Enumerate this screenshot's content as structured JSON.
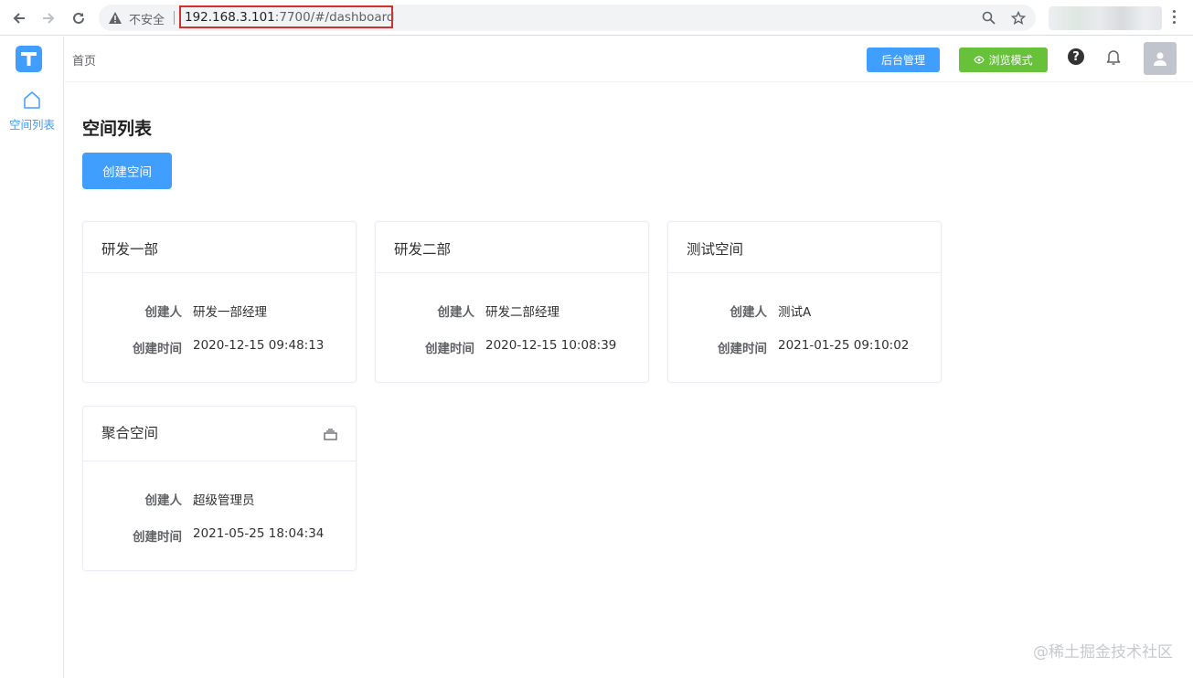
{
  "browser": {
    "insecure_label": "不安全",
    "url_host": "192.168.3.101",
    "url_rest": ":7700/#/dashboard"
  },
  "sidebar": {
    "logo_letter": "T",
    "items": [
      {
        "label": "空间列表",
        "icon": "home-icon"
      }
    ]
  },
  "header": {
    "breadcrumb": "首页",
    "admin_label": "后台管理",
    "browse_label": "浏览模式",
    "help_glyph": "?"
  },
  "main": {
    "title": "空间列表",
    "create_label": "创建空间",
    "creator_key": "创建人",
    "time_key": "创建时间",
    "spaces": [
      {
        "name": "研发一部",
        "creator": "研发一部经理",
        "created": "2020-12-15 09:48:13"
      },
      {
        "name": "研发二部",
        "creator": "研发二部经理",
        "created": "2020-12-15 10:08:39"
      },
      {
        "name": "测试空间",
        "creator": "测试A",
        "created": "2021-01-25 09:10:02"
      },
      {
        "name": "聚合空间",
        "creator": "超级管理员",
        "created": "2021-05-25 18:04:34",
        "icon": "layers-icon"
      }
    ]
  },
  "watermark": "@稀土掘金技术社区",
  "colors": {
    "primary": "#409eff",
    "success": "#67c23a",
    "highlight": "#d0302e"
  }
}
